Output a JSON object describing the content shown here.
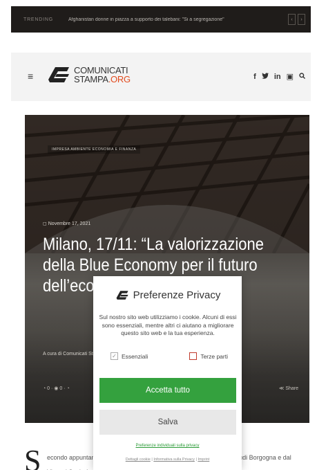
{
  "trending": {
    "label": "TRENDING",
    "headline": "Afghanistan donne in piazza a supporto dei talebani: \"Si a segregazione\"",
    "prev_icon": "chevron-left-icon",
    "next_icon": "chevron-right-icon"
  },
  "header": {
    "menu_icon": "≡",
    "logo_line1": "COMUNICATI",
    "logo_line2": "STAMPA",
    "logo_org": ".ORG",
    "social": [
      "f",
      "♥",
      "in",
      "▣",
      "⚲"
    ],
    "colors": {
      "brand_orange": "#e24b1e"
    }
  },
  "article": {
    "category": "IMPRESA AMBIENTE ECONOMIA E FINANZA",
    "date": "◻ Novembre 17, 2021",
    "title": "Milano, 17/11: “La valorizzazione della Blue Economy per il futuro dell’economia",
    "byline": "A cura di Comunicati Stampa",
    "meta": "◔ 0 · ◉ 0 · ◔",
    "share": "≪ Share",
    "dropcap": "S",
    "body": "econdo appuntamento del ciclo di conferenze promosso dal Centro Studi Borgogna e dal Vinacci Società di Storia: il rispetto di diritto"
  },
  "privacy": {
    "title": "Preferenze Privacy",
    "description": "Sul nostro sito web utilizziamo i cookie. Alcuni di essi sono essenziali, mentre altri ci aiutano a migliorare questo sito web e la tua esperienza.",
    "check_essential": "Essenziali",
    "check_third": "Terze parti",
    "accept_label": "Accetta tutto",
    "save_label": "Salva",
    "individual_link": "Preferenze individuali sulla privacy",
    "footer_cookie": "Dettagli cookie",
    "footer_privacy": "Informativa sulla Privacy",
    "footer_imprint": "Imprint",
    "colors": {
      "accept_green": "#34a13e"
    }
  }
}
